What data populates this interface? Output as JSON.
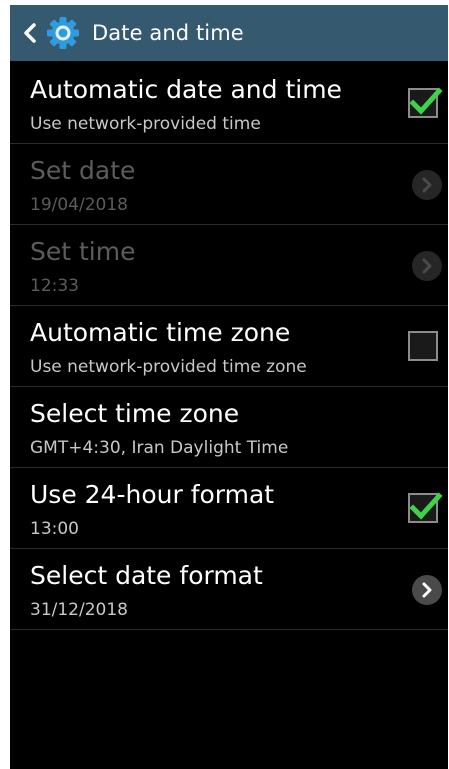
{
  "header": {
    "title": "Date and time"
  },
  "colors": {
    "action_bar": "#35596f",
    "check_green": "#3fd14a",
    "background": "#000000"
  },
  "icons": {
    "back": "back-chevron-icon",
    "settings": "gear-icon",
    "checkbox": "checkbox-icon",
    "arrow": "chevron-right-icon"
  },
  "settings": [
    {
      "title": "Automatic date and time",
      "subtitle": "Use network-provided time",
      "control": "checkbox",
      "checked": true,
      "enabled": true
    },
    {
      "title": "Set date",
      "subtitle": "19/04/2018",
      "control": "arrow",
      "enabled": false
    },
    {
      "title": "Set time",
      "subtitle": "12:33",
      "control": "arrow",
      "enabled": false
    },
    {
      "title": "Automatic time zone",
      "subtitle": "Use network-provided time zone",
      "control": "checkbox",
      "checked": false,
      "enabled": true
    },
    {
      "title": "Select time zone",
      "subtitle": "GMT+4:30, Iran Daylight Time",
      "control": "none",
      "enabled": true
    },
    {
      "title": "Use 24-hour format",
      "subtitle": "13:00",
      "control": "checkbox",
      "checked": true,
      "enabled": true
    },
    {
      "title": "Select date format",
      "subtitle": "31/12/2018",
      "control": "arrow",
      "enabled": true
    }
  ]
}
